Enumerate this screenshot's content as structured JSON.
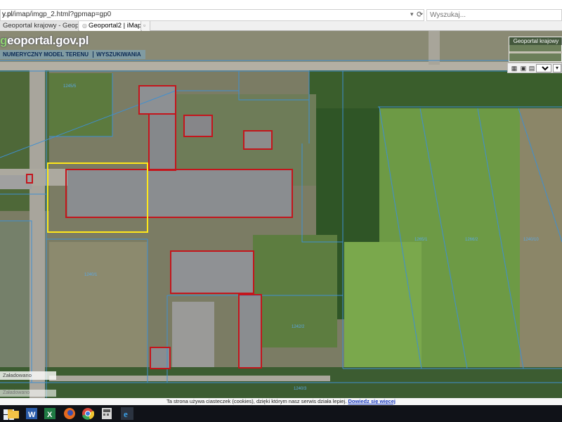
{
  "browser": {
    "url_prefix": "y.pl",
    "url_rest": "/imap/imgp_2.html?gpmap=gp0",
    "search_placeholder": "Wyszukaj...",
    "tabs": [
      {
        "label": "Geoportal krajowy - Geoportal 2"
      },
      {
        "label": "Geoportal2 | iMap"
      }
    ]
  },
  "map": {
    "logo_prefix": "g",
    "logo_main": "eoportal.gov.pl",
    "menu": [
      "NUMERYCZNY MODEL TERENU",
      "WYSZUKIWANIA"
    ],
    "overview_title": "Geoportal krajowy",
    "toolbar": {
      "format": "pdf"
    },
    "status_1": "Załadowano",
    "status_2": "Załadowano",
    "parcel_labels": [
      "1265/1",
      "1266/2",
      "1240/1",
      "1242/2",
      "1245/5",
      "1240/10",
      "1240/3"
    ]
  },
  "cookie": {
    "text": "Ta strona używa ciasteczek (cookies), dzięki którym nasz serwis działa lepiej.",
    "link": "Dowiedz się więcej"
  },
  "taskbar": {
    "icons": [
      "windows-start-icon",
      "file-explorer-icon",
      "word-icon",
      "excel-icon",
      "firefox-icon",
      "chrome-icon",
      "calculator-icon",
      "internet-explorer-icon"
    ]
  },
  "colors": {
    "parcel_line": "#3f8fd0",
    "building_outline": "#c4151c",
    "selection_outline": "#ffe81a",
    "roof": "#8a8d90",
    "field": "#6d9a45"
  }
}
